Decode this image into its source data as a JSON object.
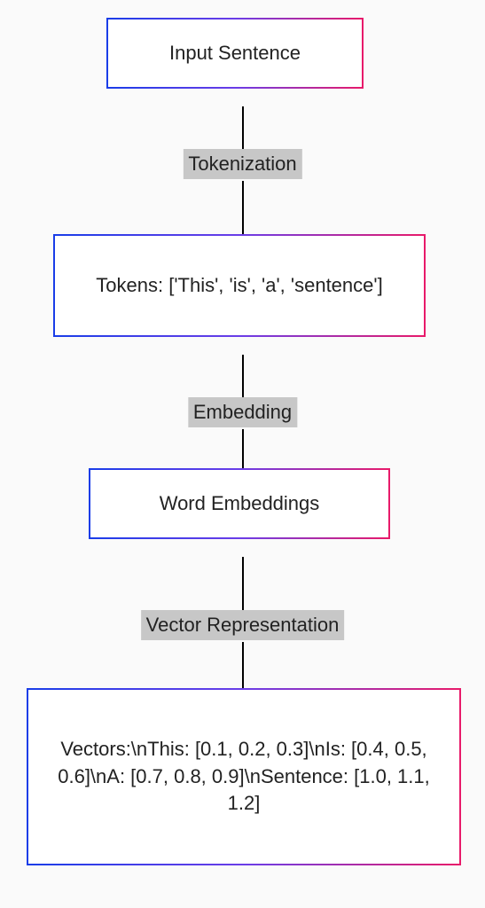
{
  "diagram": {
    "nodes": [
      {
        "id": "n1",
        "label": "Input Sentence"
      },
      {
        "id": "n2",
        "label": "Tokens: ['This', 'is', 'a', 'sentence']"
      },
      {
        "id": "n3",
        "label": "Word Embeddings"
      },
      {
        "id": "n4",
        "label": "Vectors:\\nThis: [0.1, 0.2, 0.3]\\nIs: [0.4, 0.5, 0.6]\\nA: [0.7, 0.8, 0.9]\\nSentence: [1.0, 1.1, 1.2]"
      }
    ],
    "edges": [
      {
        "from": "n1",
        "to": "n2",
        "label": "Tokenization"
      },
      {
        "from": "n2",
        "to": "n3",
        "label": "Embedding"
      },
      {
        "from": "n3",
        "to": "n4",
        "label": "Vector Representation"
      }
    ]
  }
}
